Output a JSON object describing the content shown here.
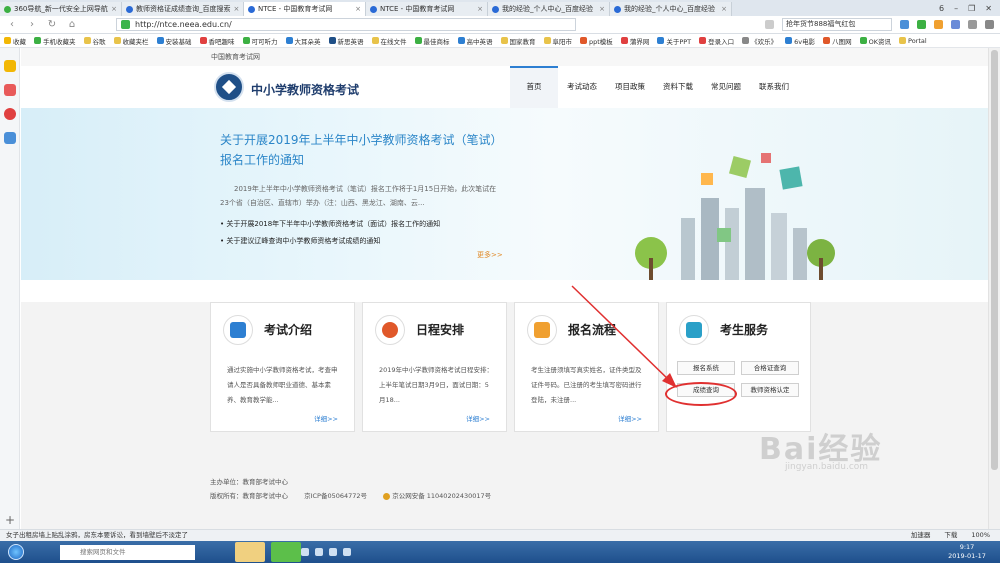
{
  "browser": {
    "tabs": [
      {
        "label": "360导航_新一代安全上网导航",
        "active": false
      },
      {
        "label": "教师资格证成绩查询_百度搜索",
        "active": false
      },
      {
        "label": "NTCE - 中国教育考试网",
        "active": true
      },
      {
        "label": "NTCE - 中国教育考试网",
        "active": false
      },
      {
        "label": "我的经验_个人中心_百度经验",
        "active": false
      },
      {
        "label": "我的经验_个人中心_百度经验",
        "active": false
      }
    ],
    "window_controls": [
      "6",
      "–",
      "❐",
      "✕"
    ],
    "url": "http://ntce.neea.edu.cn/",
    "search_text": "抢年货节888福气红包",
    "bookmarks": [
      "收藏",
      "手机收藏夹",
      "谷歌",
      "收藏夹栏",
      "安装基础",
      "香吧趣味",
      "可可听力",
      "大耳朵英",
      "新思英语",
      "在线文件",
      "最佳商标",
      "高中英语",
      "国家教育",
      "阜阳市",
      "ppt模板",
      "蒲界网",
      "关于PPT",
      "登录入口",
      "《欢乐》",
      "6v电影",
      "八图网",
      "OK资讯",
      "Portal"
    ]
  },
  "site": {
    "top_strip": "中国教育考试网",
    "title": "中小学教师资格考试",
    "menu": [
      "首页",
      "考试动态",
      "项目政策",
      "资料下载",
      "常见问题",
      "联系我们"
    ],
    "active_menu": "首页"
  },
  "banner": {
    "title": "关于开展2019年上半年中小学教师资格考试（笔试）报名工作的通知",
    "text": "2019年上半年中小学教师资格考试（笔试）报名工作将于1月15日开始，此次笔试在23个省（自治区、直辖市）举办（注：山西、黑龙江、湖南、云...",
    "links": [
      "关于开展2018年下半年中小学教师资格考试（面试）报名工作的通知",
      "关于建议辽峰查询中小学教师资格考试成绩的通知"
    ],
    "more": "更多>>"
  },
  "cards": [
    {
      "title": "考试介绍",
      "text": "通过实施中小学教师资格考试，考查申请人是否具备教师职业道德、基本素养、教育教学能...",
      "more": "详细>>",
      "icon": "book-pen-icon",
      "color": "#2d7fd2"
    },
    {
      "title": "日程安排",
      "text": "2019年中小学教师资格考试日程安排：上半年笔试日期3月9日，面试日期：5月18...",
      "more": "详细>>",
      "icon": "checkmark-icon",
      "color": "#e0582a"
    },
    {
      "title": "报名流程",
      "text": "考生注册须填写真实姓名，证件类型及证件号码。已注册的考生填写密码进行登陆，未注册...",
      "more": "详细>>",
      "icon": "form-pen-icon",
      "color": "#f0a030"
    },
    {
      "title": "考生服务",
      "icon": "person-card-icon",
      "color": "#2aa0c8"
    }
  ],
  "service_buttons": [
    "报名系统",
    "合格证查询",
    "成绩查询",
    "教师资格认定"
  ],
  "footer": {
    "line1": "主办单位：教育部考试中心",
    "line2_a": "版权所有：教育部考试中心",
    "line2_b": "京ICP备05064772号",
    "line2_c": "京公网安备 11040202430017号"
  },
  "watermark": {
    "main": "Bai经验",
    "sub": "jingyan.baidu.com"
  },
  "status": {
    "news": "女子出租房墙上贴乱涂鸦，房东本要诉讼，看到墙壁后不淡定了",
    "right_items": [
      "加速器",
      "下载",
      "100%"
    ]
  },
  "taskbar": {
    "search_placeholder": "搜索网页和文件",
    "time": "9:17",
    "date": "2019-01-17"
  }
}
